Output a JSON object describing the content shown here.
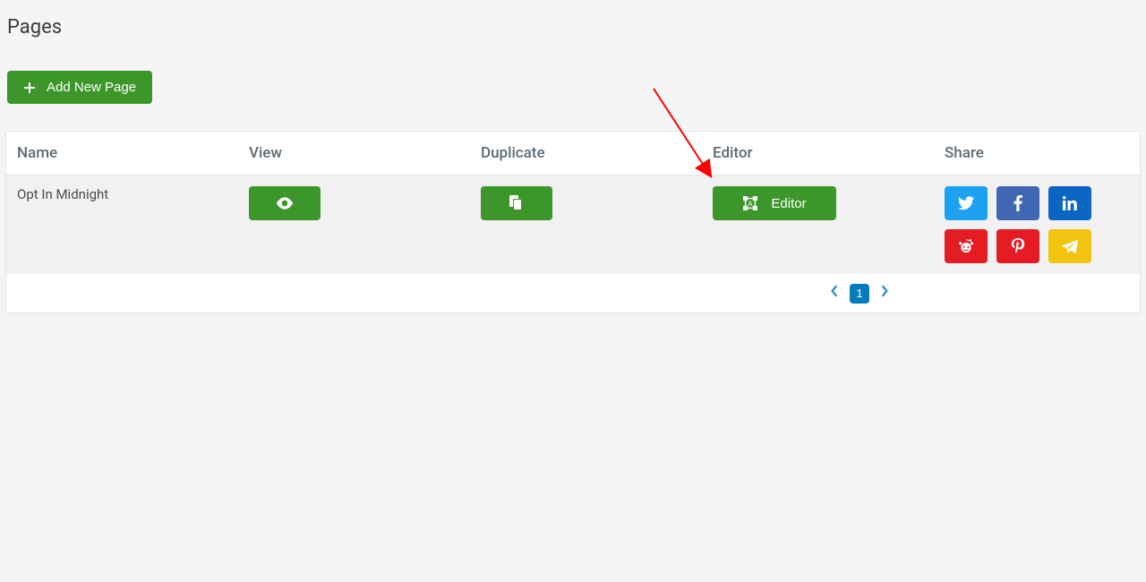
{
  "page_title": "Pages",
  "add_button_label": "Add New Page",
  "columns": {
    "name": "Name",
    "view": "View",
    "duplicate": "Duplicate",
    "editor": "Editor",
    "share": "Share"
  },
  "rows": [
    {
      "name": "Opt In Midnight",
      "editor_label": "Editor"
    }
  ],
  "pagination": {
    "current": "1"
  },
  "share_icons": {
    "twitter": "twitter-icon",
    "facebook": "facebook-icon",
    "linkedin": "linkedin-icon",
    "reddit": "reddit-icon",
    "pinterest": "pinterest-icon",
    "telegram": "telegram-icon"
  },
  "colors": {
    "green": "#3c962a",
    "twitter": "#1da1f2",
    "facebook": "#4267b2",
    "linkedin": "#0a66c2",
    "red": "#e61c25",
    "yellow": "#f1c40f",
    "page_active": "#057bbe"
  }
}
